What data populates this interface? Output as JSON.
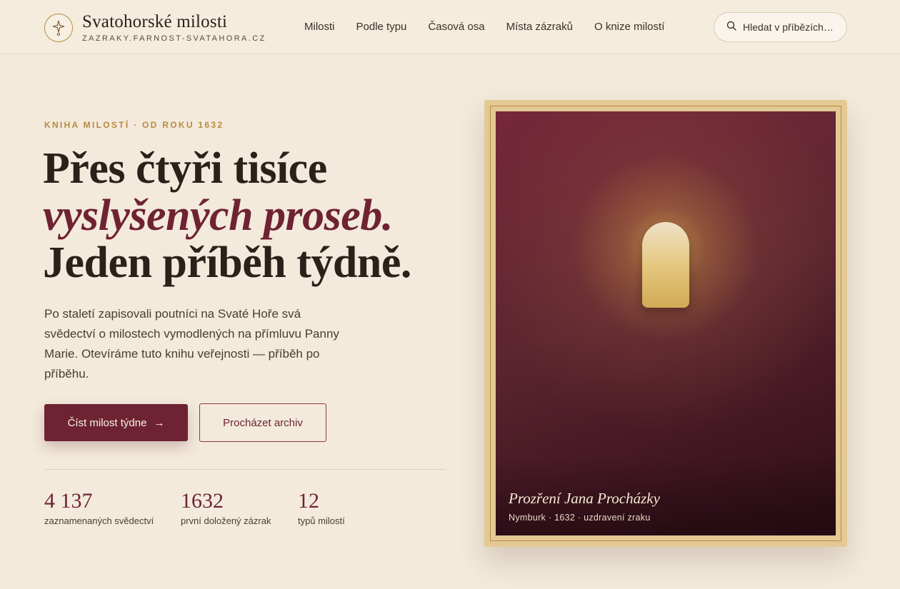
{
  "header": {
    "title": "Svatohorské milosti",
    "subtitle": "ZAZRAKY.FARNOST-SVATAHORA.CZ",
    "logo_icon": "sparkle-icon",
    "nav": [
      {
        "label": "Milosti"
      },
      {
        "label": "Podle typu"
      },
      {
        "label": "Časová osa"
      },
      {
        "label": "Místa zázraků"
      },
      {
        "label": "O knize milostí"
      }
    ],
    "search": {
      "placeholder": "Hledat v příbězích…",
      "icon": "search-icon"
    }
  },
  "hero": {
    "eyebrow": "KNIHA MILOSTÍ · OD ROKU 1632",
    "headline_line1": "Přes čtyři tisíce",
    "headline_line2": "vyslyšených proseb.",
    "headline_line3": "Jeden příběh týdně.",
    "lead": "Po staletí zapisovali poutníci na Svaté Hoře svá svědectví o milostech vymodlených na přímluvu Panny Marie. Otevíráme tuto knihu veřejnosti — příběh po příběhu.",
    "primary_button": "Číst milost týdne",
    "primary_arrow": "→",
    "secondary_button": "Procházet archiv"
  },
  "stats": [
    {
      "value": "4 137",
      "label": "zaznamenaných svědectví"
    },
    {
      "value": "1632",
      "label": "první doložený zázrak"
    },
    {
      "value": "12",
      "label": "typů milostí"
    }
  ],
  "featured": {
    "title": "Prozření Jana Procházky",
    "meta": "Nymburk · 1632 · uzdravení zraku"
  },
  "colors": {
    "background": "#f3eadb",
    "accent": "#6d2333",
    "gold": "#b98a3e"
  }
}
